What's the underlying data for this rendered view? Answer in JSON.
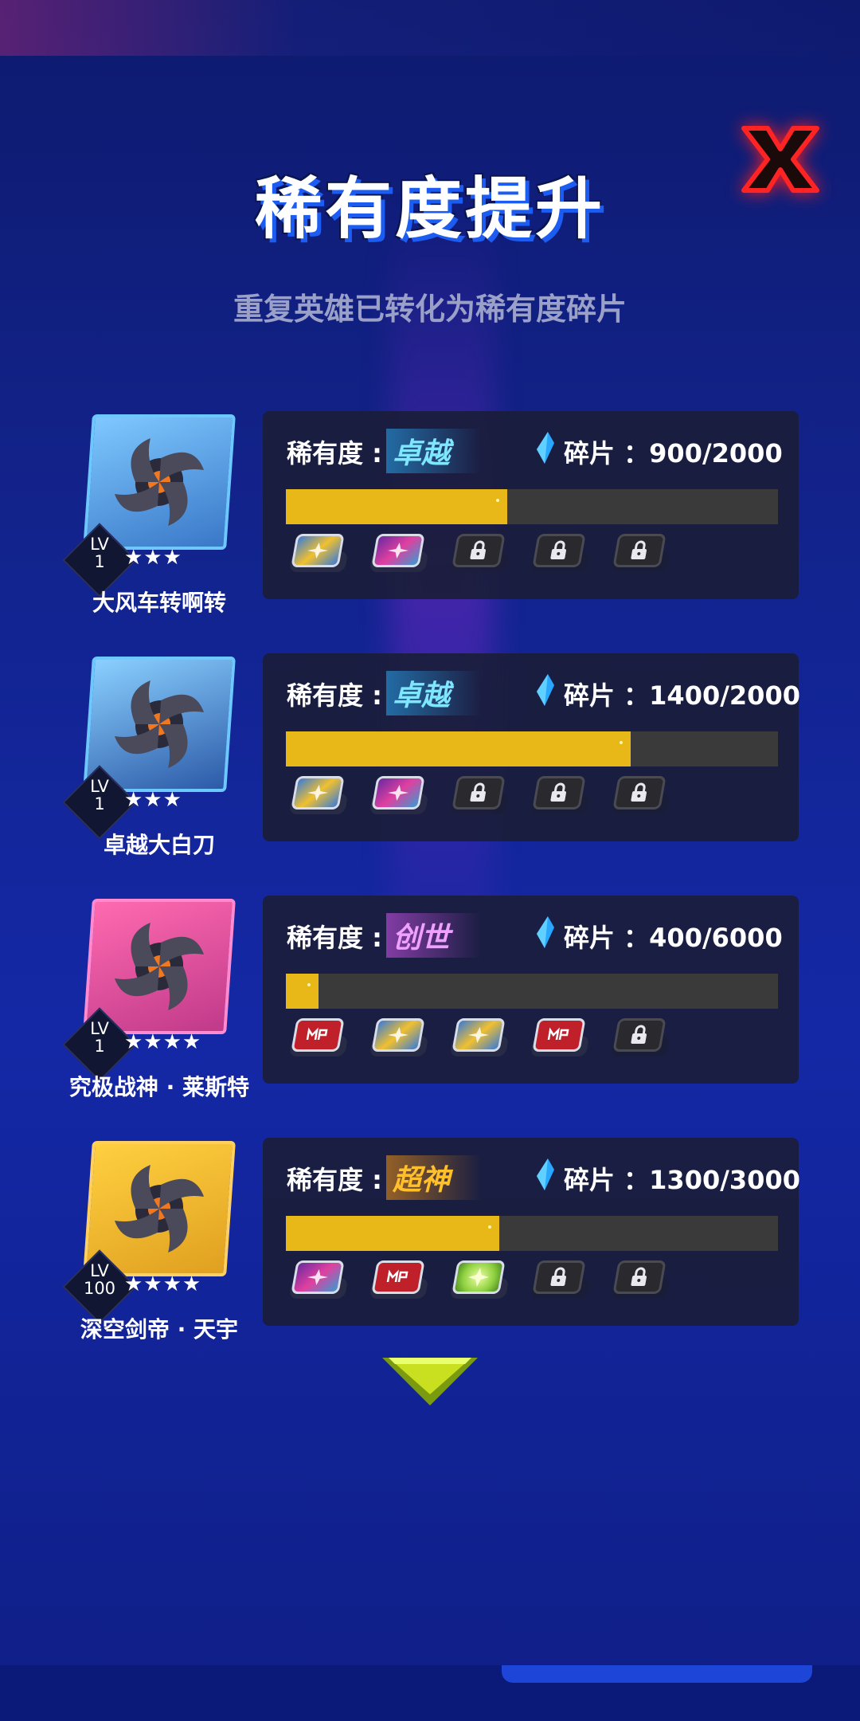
{
  "title": "稀有度提升",
  "subtitle": "重复英雄已转化为稀有度碎片",
  "labels": {
    "rarity_prefix": "稀有度 :",
    "fragment_prefix": "碎片 ："
  },
  "colors": {
    "progress_fill": "#e8b818",
    "progress_track": "#3a3a3a",
    "panel_bg": "#1a1d3a",
    "close_red": "#e01820"
  },
  "heroes": [
    {
      "name": "大风车转啊转",
      "lv_label": "LV",
      "level": "1",
      "stars": "★★★",
      "rarity": "卓越",
      "fragments": "900/2000",
      "progress": 0.45,
      "chips": [
        "blue",
        "pink",
        "locked",
        "locked",
        "locked"
      ]
    },
    {
      "name": "卓越大白刀",
      "lv_label": "LV",
      "level": "1",
      "stars": "★★★",
      "rarity": "卓越",
      "fragments": "1400/2000",
      "progress": 0.7,
      "chips": [
        "blue",
        "pink",
        "locked",
        "locked",
        "locked"
      ]
    },
    {
      "name": "究极战神 · 莱斯特",
      "lv_label": "LV",
      "level": "1",
      "stars": "★★★★",
      "rarity": "创世",
      "fragments": "400/6000",
      "progress": 0.0667,
      "chips": [
        "red",
        "blue",
        "blue",
        "red",
        "locked"
      ]
    },
    {
      "name": "深空剑帝 · 天宇",
      "lv_label": "LV",
      "level": "100",
      "stars": "★★★★",
      "rarity": "超神",
      "fragments": "1300/3000",
      "progress": 0.4333,
      "chips": [
        "pink",
        "red",
        "green",
        "locked",
        "locked"
      ]
    }
  ]
}
